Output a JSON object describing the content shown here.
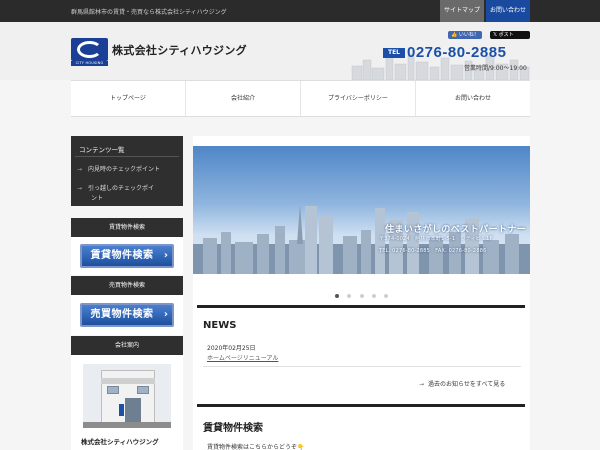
{
  "topbar": {
    "tagline": "群馬県館林市の賃貸・売買なら株式会社シティハウジング",
    "sitemap": "サイトマップ",
    "contact": "お問い合わせ"
  },
  "header": {
    "logo_ribbon": "CITY HOUSING",
    "company_name": "株式会社シティハウジング",
    "share": {
      "like": "いいね！",
      "post": "ポスト"
    },
    "tel_label": "TEL",
    "tel_number": "0276-80-2885",
    "hours": "営業時間/9:00〜19:00"
  },
  "nav": [
    "トップページ",
    "会社紹介",
    "プライバシーポリシー",
    "お問い合わせ"
  ],
  "sidebar": {
    "contents_title": "コンテンツ一覧",
    "contents_items": [
      "内見時のチェックポイント",
      "引っ越しのチェックポイ",
      "ント"
    ],
    "rental_title": "賃貸物件検索",
    "rental_button": "賃貸物件検索",
    "sale_title": "売買物件検索",
    "sale_button": "売買物件検索",
    "company_title": "会社案内",
    "company_name": "株式会社シティハウジング"
  },
  "hero": {
    "copy": "住まいさがしのベストパートナー",
    "address": "〒374-0024　館林市本町1-5-1　シティビル1F",
    "tel": "TEL. 0276-80-2885　FAX. 0276-80-2886",
    "slides": 5,
    "active_slide": 1
  },
  "news": {
    "title": "NEWS",
    "items": [
      {
        "date": "2020年02月25日",
        "title": "ホームページリニューアル"
      }
    ],
    "more": "過去のお知らせをすべて見る"
  },
  "rental_search": {
    "title": "賃貸物件検索",
    "description": "賃貸物件検索はこちらからどうぞ👇"
  },
  "colors": {
    "brand_blue": "#1b4fa8",
    "topbar": "#2b2b2b",
    "contact_blue": "#1a4aa0"
  }
}
